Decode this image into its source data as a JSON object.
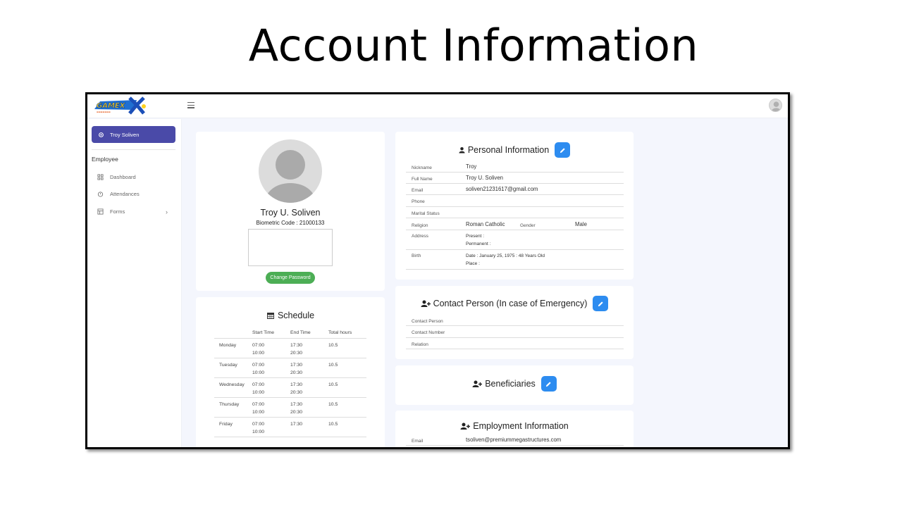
{
  "slide": {
    "title": "Account Information"
  },
  "topbar": {
    "logo_text": "GAMEX"
  },
  "sidebar": {
    "user_name": "Troy Soliven",
    "section": "Employee",
    "items": [
      {
        "label": "Dashboard",
        "icon": "grid-icon"
      },
      {
        "label": "Attendances",
        "icon": "clock-icon"
      },
      {
        "label": "Forms",
        "icon": "form-icon"
      }
    ]
  },
  "profile": {
    "name": "Troy U. Soliven",
    "biometric": "Biometric Code : 21000133",
    "change_password": "Change Password"
  },
  "schedule": {
    "title": "Schedule",
    "headers": [
      "",
      "Start Time",
      "End Time",
      "Total hours"
    ],
    "rows": [
      {
        "day": "Monday",
        "start": "07:00",
        "start2": "10:00",
        "end": "17:30",
        "end2": "20:30",
        "total": "10.5"
      },
      {
        "day": "Tuesday",
        "start": "07:00",
        "start2": "10:00",
        "end": "17:30",
        "end2": "20:30",
        "total": "10.5"
      },
      {
        "day": "Wednesday",
        "start": "07:00",
        "start2": "10:00",
        "end": "17:30",
        "end2": "20:30",
        "total": "10.5"
      },
      {
        "day": "Thursday",
        "start": "07:00",
        "start2": "10:00",
        "end": "17:30",
        "end2": "20:30",
        "total": "10.5"
      },
      {
        "day": "Friday",
        "start": "07:00",
        "start2": "10:00",
        "end": "17:30",
        "end2": "",
        "total": "10.5"
      }
    ]
  },
  "personal": {
    "title": "Personal Information",
    "nickname_label": "Nickname",
    "nickname": "Troy",
    "fullname_label": "Full Name",
    "fullname": "Troy U. Soliven",
    "email_label": "Email",
    "email": "soliven21231617@gmail.com",
    "phone_label": "Phone",
    "marital_label": "Marital Status",
    "religion_label": "Religion",
    "religion": "Roman Catholic",
    "gender_label": "Gender",
    "gender": "Male",
    "address_label": "Address",
    "present": "Present :",
    "permanent": "Permanent :",
    "birth_label": "Birth",
    "birth_date": "Date : January 25, 1975 : 48 Years Old",
    "birth_place": "Place :"
  },
  "contact": {
    "title": "Contact Person (In case of Emergency)",
    "person_label": "Contact Person",
    "number_label": "Contact Number",
    "relation_label": "Relation"
  },
  "beneficiaries": {
    "title": "Beneficiaries"
  },
  "employment": {
    "title": "Employment Information",
    "email_label": "Email",
    "email": "tsoliven@premiummegastructures.com"
  },
  "colors": {
    "accent": "#4a4aa8",
    "edit": "#2d8cf0",
    "success": "#4cae55"
  }
}
